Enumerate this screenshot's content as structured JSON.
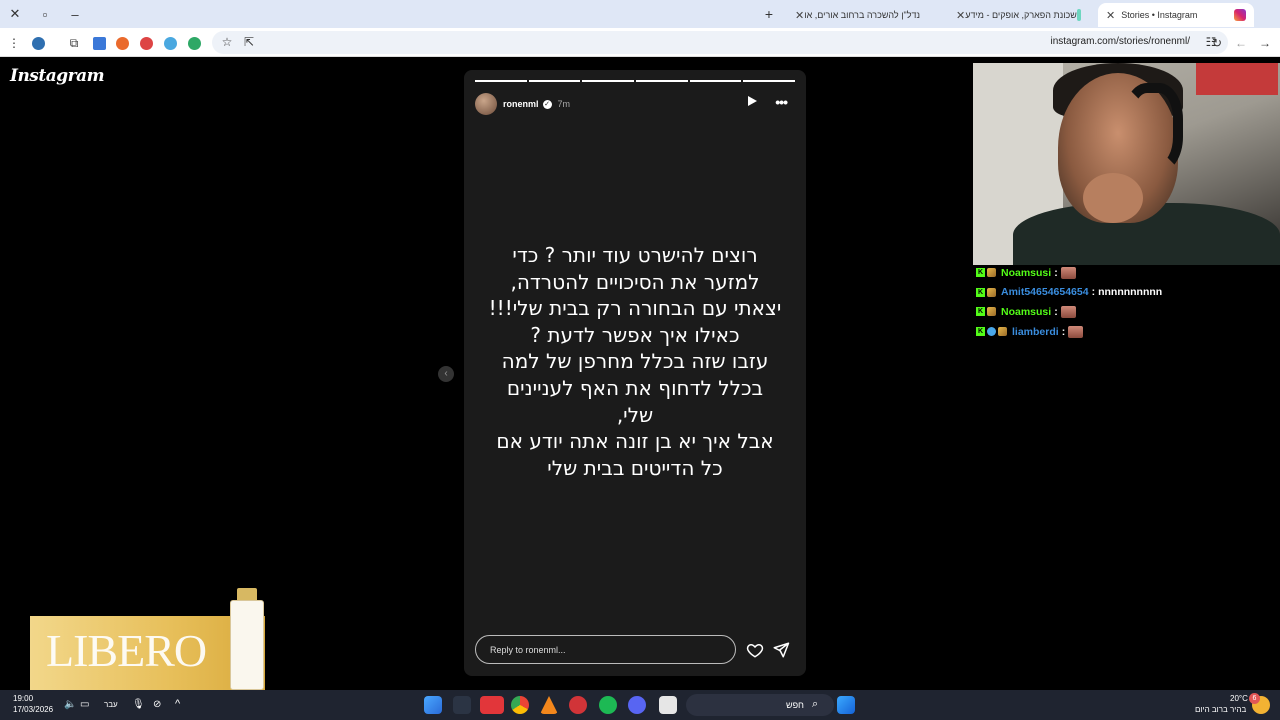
{
  "browser": {
    "tabs": [
      {
        "title": "Stories • Instagram",
        "active": true
      },
      {
        "title": "שכונת הפארק, אופקים - מידע",
        "active": false
      },
      {
        "title": "נדל\"ן להשכרה ברחוב אורים, או",
        "active": false
      }
    ],
    "url": "instagram.com/stories/ronenml/"
  },
  "page": {
    "logo": "Instagram",
    "story": {
      "username": "ronenml",
      "time_ago": "7m",
      "progress_total": 6,
      "progress_done": 6,
      "text_lines": [
        "רוצים להישרט עוד יותר ? כדי",
        "למזער את הסיכויים להטרדה,",
        "יצאתי עם הבחורה רק בבית שלי!!!",
        "כאילו איך אפשר לדעת ?",
        "עזבו שזה בכלל מחרפן של למה",
        "בכלל לדחוף את האף לעניינים",
        "שלי,",
        "אבל איך יא בן זונה אתה יודע אם",
        "כל הדייטים בבית שלי"
      ],
      "reply_placeholder": "Reply to ronenml..."
    }
  },
  "chat": [
    {
      "user": "Noamsusi",
      "user_color": "#53fc18",
      "message": "",
      "emote": true,
      "badge2": "pencil"
    },
    {
      "user": "Amit54654654654",
      "user_color": "#3a8dde",
      "message": "nnnnnnnnnn",
      "emote": false,
      "badge2": "pencil"
    },
    {
      "user": "Noamsusi",
      "user_color": "#53fc18",
      "message": "",
      "emote": true,
      "badge2": "pencil"
    },
    {
      "user": "liamberdi",
      "user_color": "#3a8dde",
      "message": "",
      "emote": true,
      "badge2": "globe"
    }
  ],
  "ad": {
    "brand": "LIBERO"
  },
  "taskbar": {
    "time": "19:00",
    "date": "17/03/2026",
    "language": "עבר",
    "search_placeholder": "חפש",
    "weather_temp": "20°C",
    "weather_desc": "בהיר ברוב היום",
    "notifications": "6"
  }
}
